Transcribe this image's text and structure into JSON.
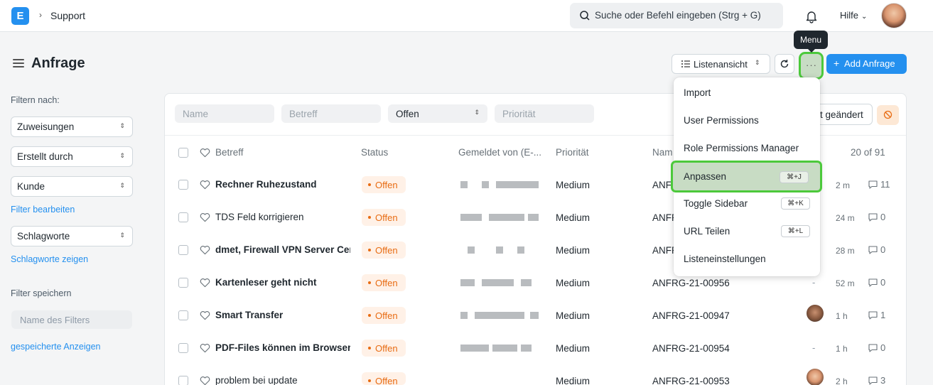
{
  "navbar": {
    "logo_letter": "E",
    "breadcrumb": "Support",
    "search_placeholder": "Suche oder Befehl eingeben (Strg + G)",
    "help_label": "Hilfe"
  },
  "page": {
    "title": "Anfrage",
    "list_view_label": "Listenansicht",
    "more_dots": "···",
    "add_button": "Add Anfrage",
    "tooltip": "Menu"
  },
  "sidebar": {
    "filter_heading": "Filtern nach:",
    "filters": [
      "Zuweisungen",
      "Erstellt durch",
      "Kunde"
    ],
    "edit_filters_link": "Filter bearbeiten",
    "tags_select": "Schlagworte",
    "show_tags_link": "Schlagworte zeigen",
    "save_filter_heading": "Filter speichern",
    "filter_name_placeholder": "Name des Filters",
    "saved_views_link": "gespeicherte Anzeigen"
  },
  "filters": {
    "name_placeholder": "Name",
    "subject_placeholder": "Betreff",
    "status_value": "Offen",
    "priority_placeholder": "Priorität",
    "sort_label": "t geändert"
  },
  "table": {
    "headers": {
      "subject": "Betreff",
      "status": "Status",
      "reported_by": "Gemeldet von (E-...",
      "priority": "Priorität",
      "name": "Nam",
      "count": "20 of 91"
    },
    "rows": [
      {
        "title": "Rechner Ruhezustand",
        "status": "Offen",
        "priority": "Medium",
        "id": "ANFR",
        "time": "2 m",
        "comments": "11"
      },
      {
        "title": "TDS Feld korrigieren",
        "status": "Offen",
        "priority": "Medium",
        "id": "ANFR",
        "time": "24 m",
        "comments": "0"
      },
      {
        "title": "dmet, Firewall VPN Server Cer",
        "status": "Offen",
        "priority": "Medium",
        "id": "ANFR",
        "time": "28 m",
        "comments": "0"
      },
      {
        "title": "Kartenleser geht nicht",
        "status": "Offen",
        "priority": "Medium",
        "id": "ANFRG-21-00956",
        "assigned": "-",
        "time": "52 m",
        "comments": "0"
      },
      {
        "title": "Smart Transfer",
        "status": "Offen",
        "priority": "Medium",
        "id": "ANFRG-21-00947",
        "time": "1 h",
        "comments": "1"
      },
      {
        "title": "PDF-Files können im Browser ü",
        "status": "Offen",
        "priority": "Medium",
        "id": "ANFRG-21-00954",
        "assigned": "-",
        "time": "1 h",
        "comments": "0"
      },
      {
        "title": "problem bei update",
        "status": "Offen",
        "priority": "Medium",
        "id": "ANFRG-21-00953",
        "time": "2 h",
        "comments": "3"
      }
    ]
  },
  "menu": {
    "items": [
      {
        "label": "Import",
        "shortcut": ""
      },
      {
        "label": "User Permissions",
        "shortcut": ""
      },
      {
        "label": "Role Permissions Manager",
        "shortcut": ""
      },
      {
        "label": "Anpassen",
        "shortcut": "⌘+J"
      },
      {
        "label": "Toggle Sidebar",
        "shortcut": "⌘+K"
      },
      {
        "label": "URL Teilen",
        "shortcut": "⌘+L"
      },
      {
        "label": "Listeneinstellungen",
        "shortcut": ""
      }
    ]
  },
  "colors": {
    "primary": "#2490ef",
    "status_open": "#e86c13",
    "highlight": "#4cc93b"
  }
}
